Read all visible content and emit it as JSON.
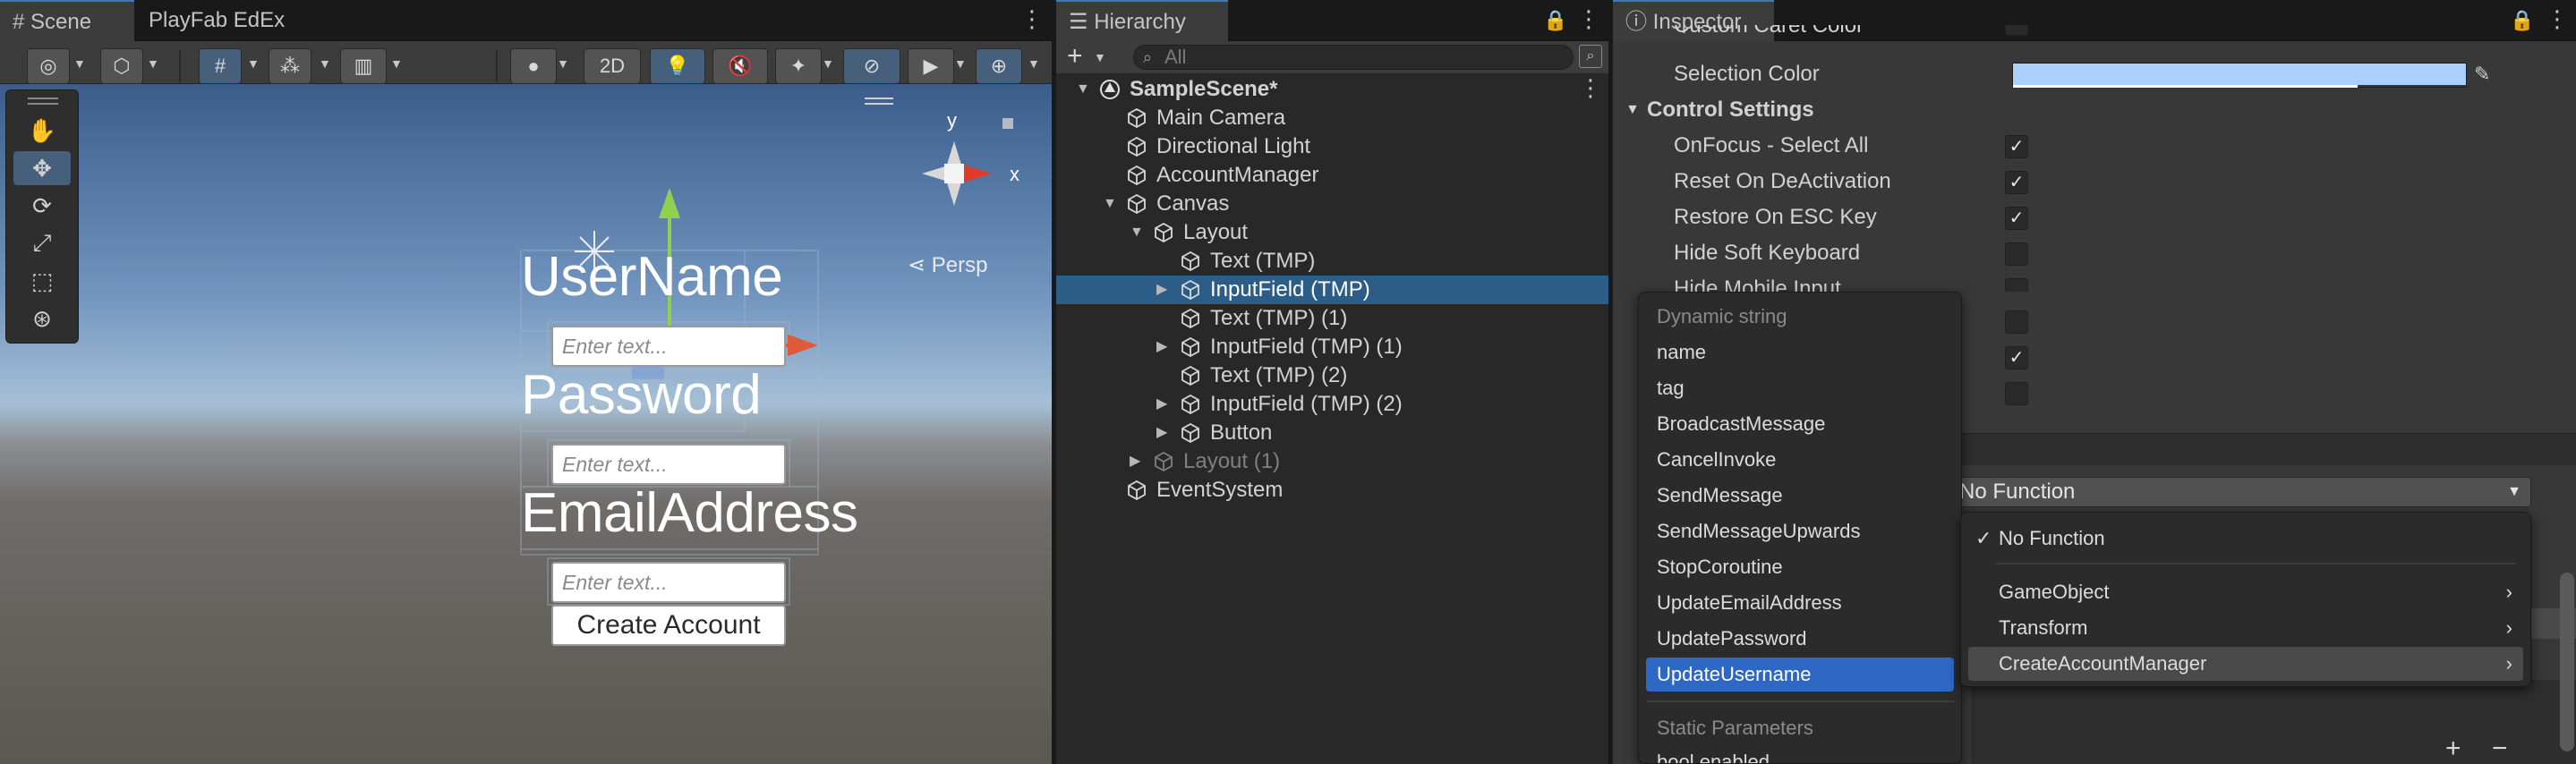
{
  "scene_panel": {
    "tabs": [
      "Scene",
      "PlayFab EdEx"
    ],
    "toolbar": {
      "mode_2d": "2D"
    },
    "gizmo": {
      "axis_x": "x",
      "axis_y": "y",
      "projection": "Persp"
    },
    "canvas": {
      "username_label": "UserName",
      "password_label": "Password",
      "email_label": "EmailAddress",
      "input_placeholder": "Enter text...",
      "create_button": "Create Account"
    }
  },
  "hierarchy": {
    "title": "Hierarchy",
    "search_placeholder": "All",
    "items": [
      {
        "label": "SampleScene*",
        "depth": 0,
        "kind": "scene"
      },
      {
        "label": "Main Camera",
        "depth": 1
      },
      {
        "label": "Directional Light",
        "depth": 1
      },
      {
        "label": "AccountManager",
        "depth": 1
      },
      {
        "label": "Canvas",
        "depth": 1
      },
      {
        "label": "Layout",
        "depth": 2
      },
      {
        "label": "Text (TMP)",
        "depth": 3
      },
      {
        "label": "InputField (TMP)",
        "depth": 3,
        "selected": true
      },
      {
        "label": "Text (TMP) (1)",
        "depth": 3
      },
      {
        "label": "InputField (TMP) (1)",
        "depth": 3
      },
      {
        "label": "Text (TMP) (2)",
        "depth": 3
      },
      {
        "label": "InputField (TMP) (2)",
        "depth": 3
      },
      {
        "label": "Button",
        "depth": 3
      },
      {
        "label": "Layout (1)",
        "depth": 2,
        "disabled": true
      },
      {
        "label": "EventSystem",
        "depth": 1
      }
    ]
  },
  "inspector": {
    "title": "Inspector",
    "custom_caret_label": "Custom Caret Color",
    "selection_color_label": "Selection Color",
    "selection_color_value": "#a9d1fb",
    "control_settings_label": "Control Settings",
    "settings": [
      {
        "label": "OnFocus - Select All",
        "checked": true
      },
      {
        "label": "Reset On DeActivation",
        "checked": true
      },
      {
        "label": "Restore On ESC Key",
        "checked": true
      },
      {
        "label": "Hide Soft Keyboard",
        "checked": false
      },
      {
        "label": "Hide Mobile Input",
        "checked": false
      }
    ],
    "function_dropdown_value": "No Function"
  },
  "method_menu": {
    "dynamic_header": "Dynamic string",
    "items": [
      "name",
      "tag",
      "BroadcastMessage",
      "CancelInvoke",
      "SendMessage",
      "SendMessageUpwards",
      "StopCoroutine",
      "UpdateEmailAddress",
      "UpdatePassword",
      "UpdateUsername"
    ],
    "highlighted": "UpdateUsername",
    "static_header": "Static Parameters",
    "cut_item": "bool enabled"
  },
  "function_menu": {
    "items": [
      "No Function",
      "GameObject",
      "Transform",
      "CreateAccountManager"
    ],
    "checked": "No Function",
    "highlighted": "CreateAccountManager"
  },
  "colors": {
    "accent": "#2c5d87",
    "highlight": "#2f68c4",
    "selection_swatch": "#a9d1fb"
  }
}
